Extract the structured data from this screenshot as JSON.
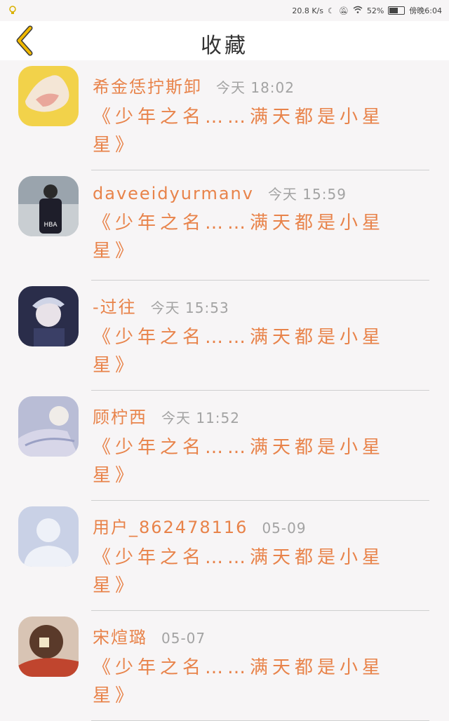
{
  "status": {
    "speed": "20.8 K/s",
    "battery": "52%",
    "time": "傍晚6:04"
  },
  "header": {
    "title": "收藏",
    "back_icon": "chevron-left-icon",
    "back_color": "#f0b800"
  },
  "colors": {
    "accent": "#e8834a",
    "time_gray": "#a3a3a3"
  },
  "favorites": [
    {
      "username": "希金恁拧斯卸",
      "time": "今天 18:02",
      "content": "《少年之名……满天都是小星星》"
    },
    {
      "username": "daveeidyurmanv",
      "time": "今天 15:59",
      "content": "《少年之名……满天都是小星星》"
    },
    {
      "username": "-过往",
      "time": "今天 15:53",
      "content": "《少年之名……满天都是小星星》"
    },
    {
      "username": "顾柠西",
      "time": "今天 11:52",
      "content": "《少年之名……满天都是小星星》"
    },
    {
      "username": "用户_862478116",
      "time": "05-09",
      "content": "《少年之名……满天都是小星星》"
    },
    {
      "username": "宋煊璐",
      "time": "05-07",
      "content": "《少年之名……满天都是小星星》"
    }
  ]
}
